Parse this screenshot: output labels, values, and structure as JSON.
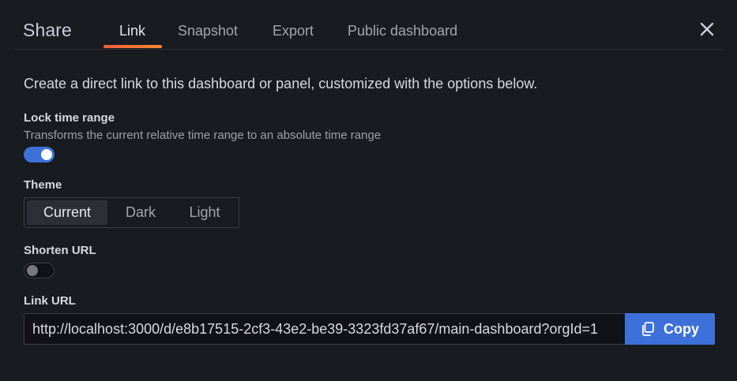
{
  "header": {
    "title": "Share",
    "tabs": [
      {
        "label": "Link",
        "active": true
      },
      {
        "label": "Snapshot",
        "active": false
      },
      {
        "label": "Export",
        "active": false
      },
      {
        "label": "Public dashboard",
        "active": false
      }
    ],
    "close_icon": "close-icon"
  },
  "link": {
    "description": "Create a direct link to this dashboard or panel, customized with the options below.",
    "lock_time_range": {
      "label": "Lock time range",
      "description": "Transforms the current relative time range to an absolute time range",
      "enabled": true
    },
    "theme": {
      "label": "Theme",
      "options": [
        "Current",
        "Dark",
        "Light"
      ],
      "selected": "Current"
    },
    "shorten_url": {
      "label": "Shorten URL",
      "enabled": false
    },
    "link_url": {
      "label": "Link URL",
      "value": "http://localhost:3000/d/e8b17515-2cf3-43e2-be39-3323fd37af67/main-dashboard?orgId=1"
    },
    "copy_button": {
      "label": "Copy",
      "icon": "copy-icon"
    }
  },
  "colors": {
    "background": "#181b1f",
    "primary": "#3d71d9",
    "tab_underline": "#f55f3e"
  }
}
